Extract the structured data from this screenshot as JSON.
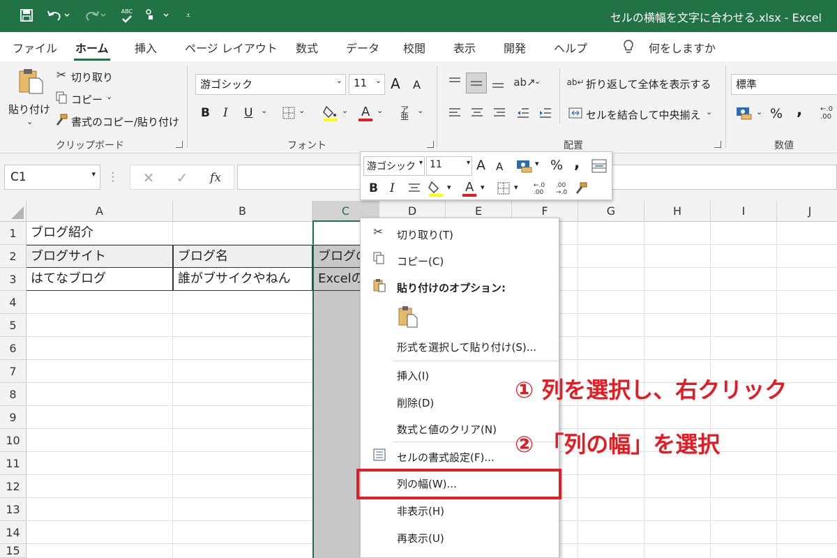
{
  "titlebar": {
    "title": "セルの横幅を文字に合わせる.xlsx  -  Excel",
    "icons": [
      "save-icon",
      "undo-icon",
      "redo-icon",
      "spelling-icon",
      "touch-mode-icon",
      "customize-icon"
    ],
    "spell_text": "ABC"
  },
  "tabs": [
    "ファイル",
    "ホーム",
    "挿入",
    "ページ レイアウト",
    "数式",
    "データ",
    "校閲",
    "表示",
    "開発",
    "ヘルプ"
  ],
  "search_placeholder": "何をしますか",
  "ribbon": {
    "clipboard": {
      "paste": "貼り付け",
      "cut": "切り取り",
      "copy": "コピー",
      "format_painter": "書式のコピー/貼り付け",
      "label": "クリップボード"
    },
    "font": {
      "font_name": "游ゴシック",
      "font_size": "11",
      "bold": "B",
      "italic": "I",
      "underline": "U",
      "grow": "A",
      "shrink": "A",
      "label": "フォント"
    },
    "alignment": {
      "wrap": "折り返して全体を表示する",
      "merge": "セルを結合して中央揃え",
      "label": "配置"
    },
    "number": {
      "format": "標準",
      "label": "数値",
      "percent": "%",
      "comma": ","
    }
  },
  "formula": {
    "namebox": "C1",
    "fx": "fx"
  },
  "columns": [
    "A",
    "B",
    "C",
    "D",
    "E",
    "F",
    "G",
    "H",
    "I",
    "J"
  ],
  "rows": [
    "1",
    "2",
    "3",
    "4",
    "5",
    "6",
    "7",
    "8",
    "9",
    "10",
    "11",
    "12",
    "13",
    "14",
    "15"
  ],
  "cells": {
    "a1": "ブログ紹介",
    "a2": "ブログサイト",
    "b2": "ブログ名",
    "c2": "ブログの",
    "a3": "はてなブログ",
    "b3": "誰がブサイクやねん",
    "c3": "Excelの"
  },
  "mini_toolbar": {
    "font_name": "游ゴシック",
    "font_size": "11",
    "percent": "%",
    "comma": "",
    "bold": "B",
    "italic": "I"
  },
  "context_menu": {
    "cut": "切り取り(T)",
    "copy": "コピー(C)",
    "paste_options": "貼り付けのオプション:",
    "paste_special": "形式を選択して貼り付け(S)...",
    "insert": "挿入(I)",
    "delete": "削除(D)",
    "clear": "数式と値のクリア(N)",
    "format_cells": "セルの書式設定(F)...",
    "column_width": "列の幅(W)...",
    "hide": "非表示(H)",
    "unhide": "再表示(U)"
  },
  "annotations": {
    "step1": "① 列を選択し、右クリック",
    "step2": "② 「列の幅」を選択"
  },
  "colors": {
    "accent": "#217346",
    "annotation": "#e31b23"
  }
}
